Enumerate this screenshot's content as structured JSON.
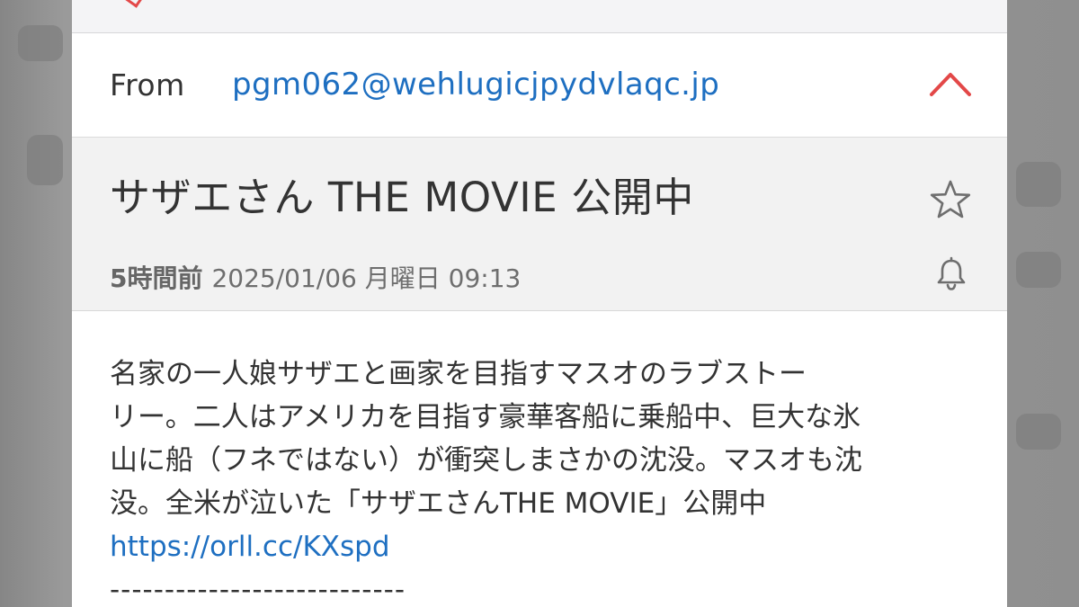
{
  "email": {
    "from_label": "From",
    "from_address": "pgm062@wehlugicjpydvlaqc.jp",
    "subject": "サザエさん THE MOVIE 公開中",
    "relative_time": "5時間前",
    "datetime": "2025/01/06 月曜日 09:13",
    "body_lines": [
      "名家の一人娘サザエと画家を目指すマスオのラブストー",
      "リー。二人はアメリカを目指す豪華客船に乗船中、巨大な氷",
      "山に船（フネではない）が衝突しまさかの沈没。マスオも沈",
      "没。全米が泣いた「サザエさんTHE MOVIE」公開中"
    ],
    "link": "https://orll.cc/KXspd",
    "divider": "---------------------------"
  },
  "icons": {
    "collapse": "chevron-up-icon",
    "favorite": "star-icon",
    "reminder": "bell-icon"
  },
  "colors": {
    "link": "#1e6fc1",
    "accent_red": "#e34848",
    "header_band": "#f2f2f2",
    "text": "#333333",
    "meta_text": "#6e6e6e"
  }
}
